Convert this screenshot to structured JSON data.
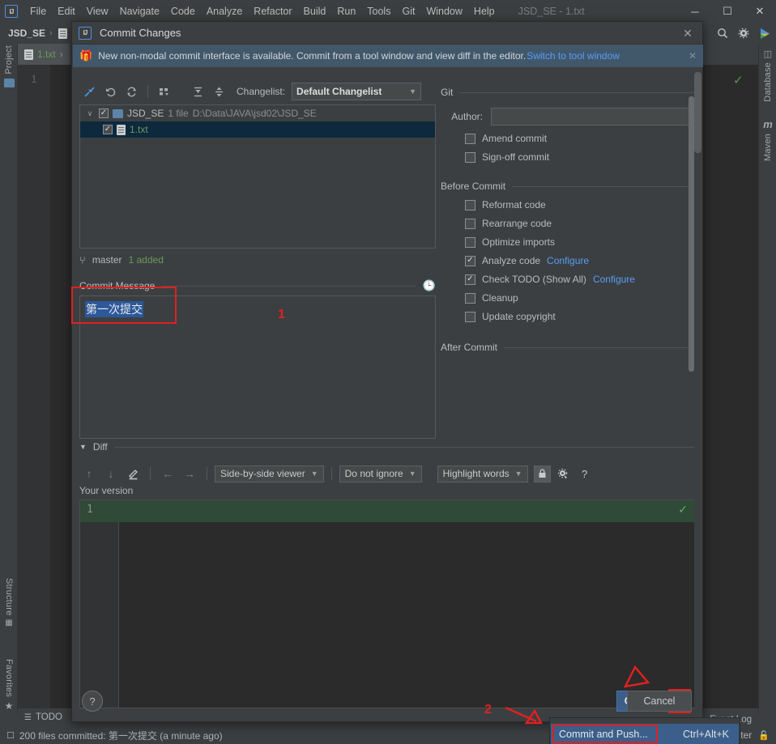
{
  "app": {
    "window_title": "JSD_SE - 1.txt",
    "logo_text": "IJ",
    "menu": [
      "File",
      "Edit",
      "View",
      "Navigate",
      "Code",
      "Analyze",
      "Refactor",
      "Build",
      "Run",
      "Tools",
      "Git",
      "Window",
      "Help"
    ],
    "window_controls": {
      "minimize": "─",
      "maximize": "☐",
      "close": "✕"
    }
  },
  "navbar": {
    "crumb_project": "JSD_SE",
    "crumb_sep": "›",
    "icons": [
      "search-icon",
      "gear-icon",
      "run-icon"
    ]
  },
  "editor": {
    "tab_label": "1.txt",
    "tab_sep": "›",
    "line_number": "1",
    "check_mark": "✓"
  },
  "left_strip": {
    "project": "Project",
    "structure": "Structure",
    "favorites": "Favorites"
  },
  "right_strip": {
    "database": "Database",
    "maven": "Maven",
    "maven_icon": "m"
  },
  "dialog": {
    "title": "Commit Changes",
    "close": "✕",
    "banner": {
      "icon": "🎁",
      "text": "New non-modal commit interface is available. Commit from a tool window and view diff in the editor.",
      "link": "Switch to tool window",
      "close": "✕"
    },
    "changelist": {
      "label": "Changelist:",
      "selected": "Default Changelist",
      "carat": "▼",
      "toolbar_icons": [
        "collapse-selection-icon",
        "rollback-icon",
        "refresh-icon",
        "group-by-icon",
        "expand-all-icon",
        "collapse-all-icon"
      ],
      "tree": {
        "root": {
          "twisty": "∨",
          "checked": "✓",
          "name": "JSD_SE",
          "count": "1 file",
          "path": "D:\\Data\\JAVA\\jsd02\\JSD_SE"
        },
        "child": {
          "checked": "✓",
          "name": "1.txt"
        }
      }
    },
    "branch": {
      "icon": "⑂",
      "name": "master",
      "status": "1 added"
    },
    "commit_message": {
      "header": "Commit Message",
      "history_icon": "🕒",
      "value": "第一次提交"
    },
    "git": {
      "header": "Git",
      "author_label": "Author:",
      "author_value": "",
      "amend_commit": {
        "label": "Amend commit",
        "checked": false
      },
      "signoff_commit": {
        "label": "Sign-off commit",
        "checked": false
      }
    },
    "before_commit": {
      "header": "Before Commit",
      "items": [
        {
          "label": "Reformat code",
          "checked": false,
          "link": ""
        },
        {
          "label": "Rearrange code",
          "checked": false,
          "link": ""
        },
        {
          "label": "Optimize imports",
          "checked": false,
          "link": ""
        },
        {
          "label": "Analyze code",
          "checked": true,
          "link": "Configure"
        },
        {
          "label": "Check TODO (Show All)",
          "checked": true,
          "link": "Configure"
        },
        {
          "label": "Cleanup",
          "checked": false,
          "link": ""
        },
        {
          "label": "Update copyright",
          "checked": false,
          "link": ""
        }
      ]
    },
    "after_commit": {
      "header": "After Commit"
    },
    "diff": {
      "header": "Diff",
      "twisty": "▼",
      "nav_icons": [
        "previous-difference-icon",
        "next-difference-icon",
        "edit-icon",
        "arrow-left-icon",
        "arrow-right-icon"
      ],
      "viewer_mode": "Side-by-side viewer",
      "whitespace_mode": "Do not ignore",
      "highlight_mode": "Highlight words",
      "carat": "▼",
      "lock_icon": "🔒",
      "settings_icon": "⚙",
      "help_icon": "?",
      "your_version_label": "Your version",
      "line_number": "1",
      "added_check": "✓"
    },
    "buttons": {
      "help": "?",
      "commit": "Commit",
      "commit_arrow": "▼",
      "cancel": "Cancel"
    },
    "popup_menu": {
      "label": "Commit and Push...",
      "shortcut": "Ctrl+Alt+K"
    }
  },
  "annotations": {
    "one": "1",
    "two": "2",
    "color": "#e02020"
  },
  "statusbar": {
    "message": "200 files committed: 第一次提交 (a minute ago)",
    "todo_tab": "TODO",
    "event_log": "Event Log",
    "branch": "ster",
    "lock_icon": "🔓"
  },
  "colors": {
    "accent_blue": "#3b5f8a",
    "link_blue": "#589df6",
    "annotation_red": "#e02020",
    "added_green": "#2f4a36",
    "selection_blue": "#2d5899",
    "banner_bg": "#41586b"
  }
}
